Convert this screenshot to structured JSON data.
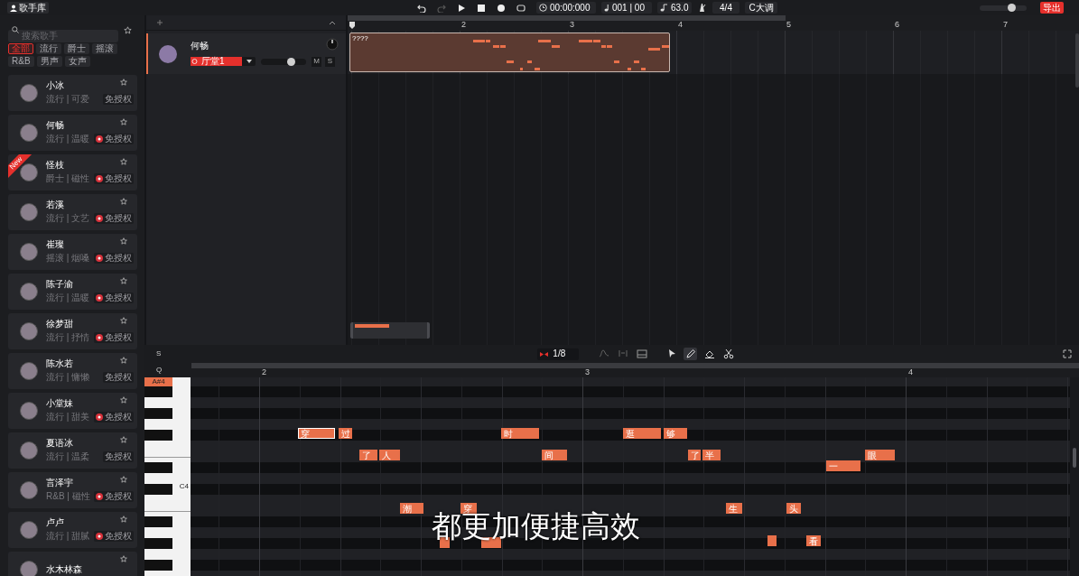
{
  "top_bar": {
    "library_button": "歌手库",
    "time": "00:00:000",
    "position": "001 | 00",
    "tempo": "63.0",
    "time_signature": "4/4",
    "key": "C大调",
    "master_volume": {
      "level": 0.68
    },
    "export_button": "导出"
  },
  "sidebar": {
    "search": {
      "placeholder": "搜索歌手"
    },
    "filters": [
      {
        "label": "全部",
        "selected": true
      },
      {
        "label": "流行",
        "selected": false
      },
      {
        "label": "爵士",
        "selected": false
      },
      {
        "label": "摇滚",
        "selected": false
      },
      {
        "label": "R&B",
        "selected": false
      },
      {
        "label": "男声",
        "selected": false
      },
      {
        "label": "女声",
        "selected": false
      }
    ],
    "singers": [
      {
        "name": "小冰",
        "tags": "流行 | 可爱",
        "badge": "免授权",
        "badge_icon": false
      },
      {
        "name": "何畅",
        "tags": "流行 | 温暖",
        "badge": "免授权",
        "badge_icon": true
      },
      {
        "name": "怪枝",
        "tags": "爵士 | 磁性",
        "badge": "免授权",
        "badge_icon": true,
        "ribbon": "New"
      },
      {
        "name": "若溪",
        "tags": "流行 | 文艺",
        "badge": "免授权",
        "badge_icon": true
      },
      {
        "name": "崔璨",
        "tags": "摇滚 | 烟嗓",
        "badge": "免授权",
        "badge_icon": true
      },
      {
        "name": "陈子渝",
        "tags": "流行 | 温暖",
        "badge": "免授权",
        "badge_icon": true
      },
      {
        "name": "徐梦甜",
        "tags": "流行 | 抒情",
        "badge": "免授权",
        "badge_icon": true
      },
      {
        "name": "陈水若",
        "tags": "流行 | 慵懒",
        "badge": "免授权",
        "badge_icon": false
      },
      {
        "name": "小堂妹",
        "tags": "流行 | 甜美",
        "badge": "免授权",
        "badge_icon": true
      },
      {
        "name": "夏语冰",
        "tags": "流行 | 温柔",
        "badge": "免授权",
        "badge_icon": false
      },
      {
        "name": "言泽宇",
        "tags": "R&B | 磁性",
        "badge": "免授权",
        "badge_icon": true
      },
      {
        "name": "卢卢",
        "tags": "流行 | 甜腻",
        "badge": "免授权",
        "badge_icon": true
      },
      {
        "name": "水木林森"
      }
    ]
  },
  "track_panel": {
    "tracks": [
      {
        "name": "何畅",
        "selected": true,
        "preset": "厅堂1",
        "volume": {
          "level": 0.66
        },
        "mute": "M",
        "solo": "S"
      }
    ]
  },
  "arrangement": {
    "bar_numbers": [
      "2",
      "3",
      "4",
      "5",
      "6",
      "7"
    ],
    "clip": {
      "label": "????"
    }
  },
  "editor_toolbar": {
    "track_letter": "S",
    "snap": "1/8",
    "tools": [
      {
        "kind": "curve",
        "selected": false
      },
      {
        "kind": "vibrato",
        "selected": false
      },
      {
        "kind": "panel",
        "selected": false
      },
      {
        "kind": "pointer",
        "selected": false
      },
      {
        "kind": "pencil",
        "selected": true
      },
      {
        "kind": "eraser",
        "selected": false
      },
      {
        "kind": "scissors",
        "selected": false
      }
    ]
  },
  "piano_roll": {
    "corner": "Q",
    "bar_numbers": [
      "2",
      "3",
      "4"
    ],
    "highlighted_key": "A#4",
    "octave_label": "C4",
    "notes": [
      {
        "lyric": "穿",
        "selected": true
      },
      {
        "lyric": "过",
        "selected": false
      },
      {
        "lyric": "了",
        "selected": false
      },
      {
        "lyric": "人",
        "selected": false
      },
      {
        "lyric": "潮",
        "selected": false
      },
      {
        "selected": false
      },
      {
        "lyric": "穿",
        "selected": false
      },
      {
        "selected": false
      },
      {
        "lyric": "时",
        "selected": false
      },
      {
        "lyric": "间",
        "selected": false
      },
      {
        "lyric": "逛",
        "selected": false
      },
      {
        "lyric": "够",
        "selected": false
      },
      {
        "lyric": "了",
        "selected": false
      },
      {
        "lyric": "半",
        "selected": false
      },
      {
        "lyric": "生",
        "selected": false
      },
      {
        "selected": false
      },
      {
        "lyric": "头",
        "selected": false
      },
      {
        "lyric": "看",
        "selected": false
      },
      {
        "lyric": "一",
        "selected": false
      },
      {
        "lyric": "眼",
        "selected": false
      }
    ]
  },
  "subtitle": "都更加便捷高效"
}
